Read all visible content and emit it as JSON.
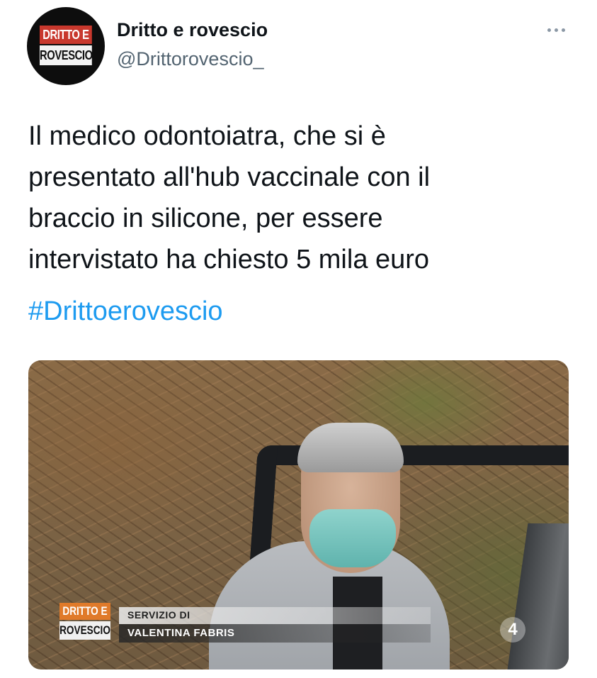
{
  "account": {
    "display_name": "Dritto e rovescio",
    "handle": "@Drittorovescio_",
    "avatar_logo": {
      "line1": "DRITTO E",
      "line2": "ROVESCIO"
    }
  },
  "tweet": {
    "text": "Il medico odontoiatra, che si è\npresentato all'hub vaccinale con il\nbraccio in silicone, per essere\nintervistato ha chiesto 5 mila euro",
    "hashtag": "#Drittoerovescio"
  },
  "media": {
    "program_logo": {
      "line1": "DRITTO E",
      "line2": "ROVESCIO"
    },
    "lower_third": {
      "label": "SERVIZIO DI",
      "name": "VALENTINA FABRIS"
    },
    "channel_logo": "4"
  },
  "colors": {
    "link": "#1d9bf0",
    "secondary_text": "#536471",
    "brand_red": "#c8382d",
    "brand_orange": "#e07a2a"
  },
  "icons": {
    "more": "more-horizontal-icon"
  }
}
